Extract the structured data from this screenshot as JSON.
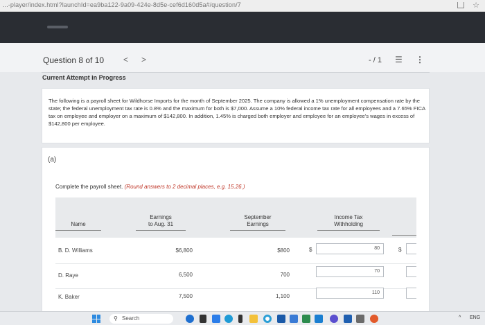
{
  "browser": {
    "url": "...-player/index.html?launchId=ea9ba122-9a09-424e-8d5e-cef6d160d5a#/question/7"
  },
  "question": {
    "title": "Question 8 of 10",
    "prev_glyph": "<",
    "next_glyph": ">",
    "score": "- / 1",
    "list_icon": "list-icon",
    "more_icon": "more-icon"
  },
  "attempt_label": "Current Attempt in Progress",
  "problem_text": "The following is a payroll sheet for Wildhorse Imports for the month of September 2025. The company is allowed a 1% unemployment compensation rate by the state; the federal unemployment tax rate is 0.8% and the maximum for both is $7,000. Assume a 10% federal income tax rate for all employees and a 7.65% FICA tax on employee and employer on a maximum of $142,800. In addition, 1.45% is charged both employer and employee for an employee's wages in excess of $142,800 per employee.",
  "part": {
    "label": "(a)",
    "instruction": "Complete the payroll sheet.",
    "hint": "(Round answers to 2 decimal places, e.g. 15.26.)"
  },
  "table": {
    "headers": {
      "name": "Name",
      "earnings_l1": "Earnings",
      "earnings_l2": "to Aug. 31",
      "sept_l1": "September",
      "sept_l2": "Earnings",
      "tax_l1": "Income Tax",
      "tax_l2": "Withholding"
    },
    "rows": [
      {
        "name": "B. D. Williams",
        "earnings": "$6,800",
        "september": "$800",
        "withholding": "80",
        "dollar": "$",
        "next_dollar": "$"
      },
      {
        "name": "D. Raye",
        "earnings": "6,500",
        "september": "700",
        "withholding": "70"
      },
      {
        "name": "K. Baker",
        "earnings": "7,500",
        "september": "1,100",
        "withholding": "110"
      }
    ]
  },
  "taskbar": {
    "search_placeholder": "Search",
    "tray_lang": "ENG",
    "tray_caret": "^"
  },
  "colors": {
    "header_dark": "#2a2d33",
    "hint_red": "#c0392b",
    "table_header_bg": "#e8eaec"
  }
}
